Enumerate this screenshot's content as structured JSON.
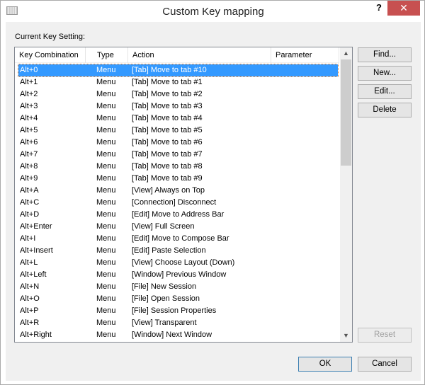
{
  "window": {
    "title": "Custom Key mapping",
    "help": "?",
    "close": "✕"
  },
  "label": "Current Key Setting:",
  "columns": [
    "Key Combination",
    "Type",
    "Action",
    "Parameter"
  ],
  "rows": [
    [
      "Alt+0",
      "Menu",
      "[Tab] Move to tab #10",
      ""
    ],
    [
      "Alt+1",
      "Menu",
      "[Tab] Move to tab #1",
      ""
    ],
    [
      "Alt+2",
      "Menu",
      "[Tab] Move to tab #2",
      ""
    ],
    [
      "Alt+3",
      "Menu",
      "[Tab] Move to tab #3",
      ""
    ],
    [
      "Alt+4",
      "Menu",
      "[Tab] Move to tab #4",
      ""
    ],
    [
      "Alt+5",
      "Menu",
      "[Tab] Move to tab #5",
      ""
    ],
    [
      "Alt+6",
      "Menu",
      "[Tab] Move to tab #6",
      ""
    ],
    [
      "Alt+7",
      "Menu",
      "[Tab] Move to tab #7",
      ""
    ],
    [
      "Alt+8",
      "Menu",
      "[Tab] Move to tab #8",
      ""
    ],
    [
      "Alt+9",
      "Menu",
      "[Tab] Move to tab #9",
      ""
    ],
    [
      "Alt+A",
      "Menu",
      "[View] Always on Top",
      ""
    ],
    [
      "Alt+C",
      "Menu",
      "[Connection] Disconnect",
      ""
    ],
    [
      "Alt+D",
      "Menu",
      "[Edit] Move to Address Bar",
      ""
    ],
    [
      "Alt+Enter",
      "Menu",
      "[View] Full Screen",
      ""
    ],
    [
      "Alt+I",
      "Menu",
      "[Edit] Move to Compose Bar",
      ""
    ],
    [
      "Alt+Insert",
      "Menu",
      "[Edit] Paste Selection",
      ""
    ],
    [
      "Alt+L",
      "Menu",
      "[View] Choose Layout (Down)",
      ""
    ],
    [
      "Alt+Left",
      "Menu",
      "[Window] Previous Window",
      ""
    ],
    [
      "Alt+N",
      "Menu",
      "[File] New Session",
      ""
    ],
    [
      "Alt+O",
      "Menu",
      "[File] Open Session",
      ""
    ],
    [
      "Alt+P",
      "Menu",
      "[File] Session Properties",
      ""
    ],
    [
      "Alt+R",
      "Menu",
      "[View] Transparent",
      ""
    ],
    [
      "Alt+Right",
      "Menu",
      "[Window] Next Window",
      ""
    ]
  ],
  "selected_index": 0,
  "buttons": {
    "find": "Find...",
    "new": "New...",
    "edit": "Edit...",
    "delete": "Delete",
    "reset": "Reset",
    "ok": "OK",
    "cancel": "Cancel"
  }
}
